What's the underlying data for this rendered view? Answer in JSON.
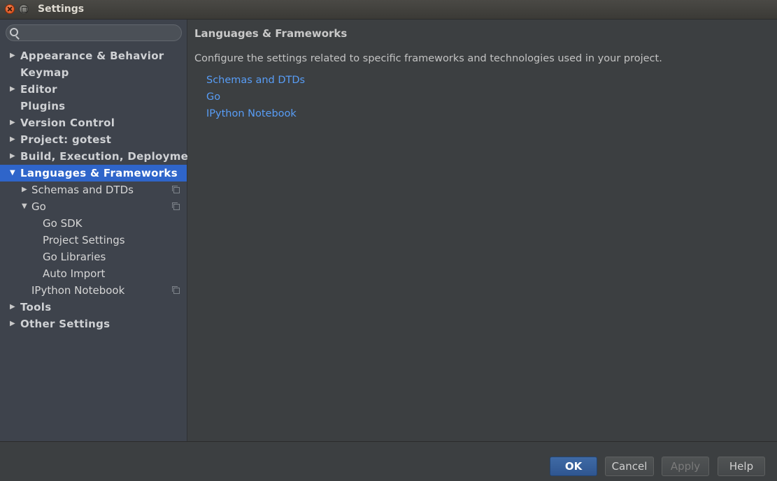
{
  "window": {
    "title": "Settings"
  },
  "sidebar": {
    "search_placeholder": "",
    "items": [
      {
        "label": "Appearance & Behavior"
      },
      {
        "label": "Keymap"
      },
      {
        "label": "Editor"
      },
      {
        "label": "Plugins"
      },
      {
        "label": "Version Control"
      },
      {
        "label": "Project: gotest"
      },
      {
        "label": "Build, Execution, Deployment"
      },
      {
        "label": "Languages & Frameworks"
      },
      {
        "label": "Schemas and DTDs"
      },
      {
        "label": "Go"
      },
      {
        "label": "Go SDK"
      },
      {
        "label": "Project Settings"
      },
      {
        "label": "Go Libraries"
      },
      {
        "label": "Auto Import"
      },
      {
        "label": "IPython Notebook"
      },
      {
        "label": "Tools"
      },
      {
        "label": "Other Settings"
      }
    ]
  },
  "main": {
    "title": "Languages & Frameworks",
    "description": "Configure the settings related to specific frameworks and technologies used in your project.",
    "links": [
      {
        "label": "Schemas and DTDs"
      },
      {
        "label": "Go"
      },
      {
        "label": "IPython Notebook"
      }
    ]
  },
  "buttons": {
    "ok": "OK",
    "cancel": "Cancel",
    "apply": "Apply",
    "help": "Help"
  },
  "colors": {
    "selection": "#2f65ca",
    "link": "#589df6",
    "primary_button": "#3a62a0"
  }
}
